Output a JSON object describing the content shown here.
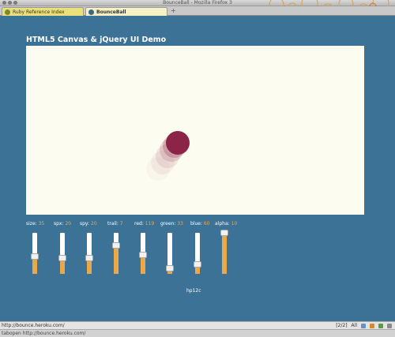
{
  "window": {
    "title": "BounceBall - Mozilla Firefox 3"
  },
  "tabs": [
    {
      "label": "Ruby Reference Index"
    },
    {
      "label": "BounceBall"
    }
  ],
  "new_tab_glyph": "+",
  "demo": {
    "title": "HTML5 Canvas & jQuery UI Demo",
    "ball_color": "#8b2446",
    "controls": [
      {
        "name": "size:",
        "value": "35",
        "level": 0.42
      },
      {
        "name": "spx:",
        "value": "20",
        "level": 0.38
      },
      {
        "name": "spy:",
        "value": "20",
        "level": 0.38
      },
      {
        "name": "trail:",
        "value": "7",
        "level": 0.7
      },
      {
        "name": "red:",
        "value": "119",
        "level": 0.47
      },
      {
        "name": "green:",
        "value": "33",
        "level": 0.13
      },
      {
        "name": "blue:",
        "value": "60",
        "level": 0.24
      },
      {
        "name": "alpha:",
        "value": "10",
        "level": 1.0
      }
    ],
    "fps": "hp12c"
  },
  "status": {
    "url": "http://bounce.heroku.com/",
    "tab_count": "[2/2]",
    "all_label": "All"
  },
  "addon_bar": {
    "text": "tabopen http://bounce.heroku.com/"
  },
  "colors": {
    "page_bg": "#3d7297",
    "canvas_bg": "#fdfcf0",
    "accent": "#e9a94b"
  }
}
